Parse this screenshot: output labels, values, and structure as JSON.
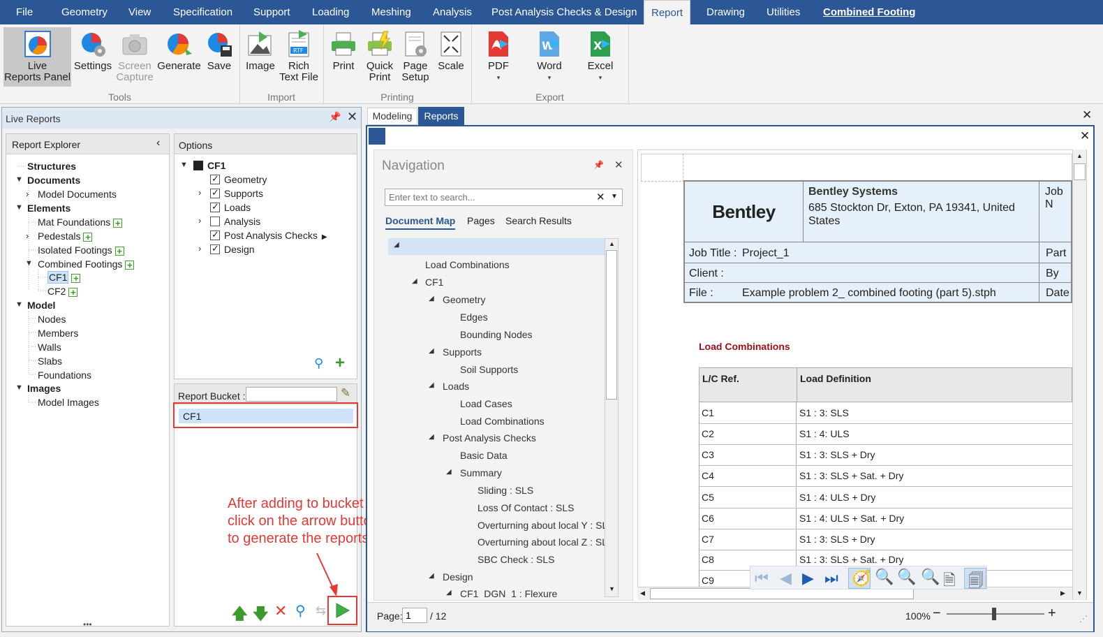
{
  "menu": [
    "File",
    "Geometry",
    "View",
    "Specification",
    "Support",
    "Loading",
    "Meshing",
    "Analysis",
    "Post Analysis Checks & Design",
    "Report",
    "Drawing",
    "Utilities",
    "Combined Footing"
  ],
  "ribbon": {
    "tools": {
      "label": "Tools",
      "buttons": [
        {
          "l1": "Live",
          "l2": "Reports Panel"
        },
        {
          "l1": "Settings",
          "l2": ""
        },
        {
          "l1": "Screen",
          "l2": "Capture"
        },
        {
          "l1": "Generate",
          "l2": ""
        },
        {
          "l1": "Save",
          "l2": ""
        }
      ]
    },
    "import": {
      "label": "Import",
      "buttons": [
        {
          "l1": "Image",
          "l2": ""
        },
        {
          "l1": "Rich",
          "l2": "Text File"
        }
      ]
    },
    "printing": {
      "label": "Printing",
      "buttons": [
        {
          "l1": "Print",
          "l2": ""
        },
        {
          "l1": "Quick",
          "l2": "Print"
        },
        {
          "l1": "Page",
          "l2": "Setup"
        },
        {
          "l1": "Scale",
          "l2": ""
        }
      ]
    },
    "export": {
      "label": "Export",
      "buttons": [
        {
          "l1": "PDF",
          "l2": "▾"
        },
        {
          "l1": "Word",
          "l2": "▾"
        },
        {
          "l1": "Excel",
          "l2": "▾"
        }
      ]
    }
  },
  "live_reports": {
    "title": "Live Reports"
  },
  "explorer": {
    "title": "Report Explorer",
    "items": [
      "Structures",
      "Documents",
      "Model Documents",
      "Elements",
      "Mat Foundations",
      "Pedestals",
      "Isolated Footings",
      "Combined Footings",
      "CF1",
      "CF2",
      "Model",
      "Nodes",
      "Members",
      "Walls",
      "Slabs",
      "Foundations",
      "Images",
      "Model Images"
    ]
  },
  "options": {
    "title": "Options",
    "root": "CF1",
    "items": [
      "Geometry",
      "Supports",
      "Loads",
      "Analysis",
      "Post Analysis Checks",
      "Design"
    ]
  },
  "bucket": {
    "label": "Report Bucket :",
    "item": "CF1"
  },
  "annotation": {
    "line1": "After adding to bucket",
    "line2": "click on the arrow button",
    "line3": "to generate the reports."
  },
  "tabs": [
    "Modeling",
    "Reports"
  ],
  "navigation": {
    "title": "Navigation",
    "search_placeholder": "Enter text to search...",
    "tabs": [
      "Document Map",
      "Pages",
      "Search Results"
    ],
    "items": [
      "Load Combinations",
      "CF1",
      "Geometry",
      "Edges",
      "Bounding Nodes",
      "Supports",
      "Soil Supports",
      "Loads",
      "Load Cases",
      "Load Combinations",
      "Post Analysis Checks",
      "Basic Data",
      "Summary",
      "Sliding : SLS",
      "Loss Of Contact : SLS",
      "Overturning about local Y : SLS",
      "Overturning about local Z : SLS",
      "SBC Check : SLS",
      "Design",
      "CF1_DGN_1 : Flexure"
    ]
  },
  "report": {
    "company": "Bentley Systems",
    "address": "685 Stockton Dr, Exton, PA 19341, United States",
    "logo": "Bentley",
    "job_no_label": "Job N",
    "job_title_label": "Job Title :",
    "job_title": "Project_1",
    "part_label": "Part",
    "client_label": "Client :",
    "by_label": "By",
    "file_label": "File :",
    "file": "Example problem 2_ combined footing (part 5).stph",
    "date_label": "Date",
    "section": "Load Combinations",
    "col1": "L/C Ref.",
    "col2": "Load Definition",
    "rows": [
      {
        "ref": "C1",
        "def": "S1 : 3: SLS"
      },
      {
        "ref": "C2",
        "def": "S1 : 4: ULS"
      },
      {
        "ref": "C3",
        "def": "S1 : 3: SLS + Dry"
      },
      {
        "ref": "C4",
        "def": "S1 : 3: SLS + Sat. + Dry"
      },
      {
        "ref": "C5",
        "def": "S1 : 4: ULS + Dry"
      },
      {
        "ref": "C6",
        "def": "S1 : 4: ULS + Sat. + Dry"
      },
      {
        "ref": "C7",
        "def": "S1 : 3: SLS + Dry"
      },
      {
        "ref": "C8",
        "def": "S1 : 3: SLS + Sat. + Dry"
      },
      {
        "ref": "C9",
        "def": ""
      }
    ]
  },
  "status": {
    "page_label": "Page:",
    "page": "1",
    "of": "/ 12",
    "zoom": "100%"
  }
}
